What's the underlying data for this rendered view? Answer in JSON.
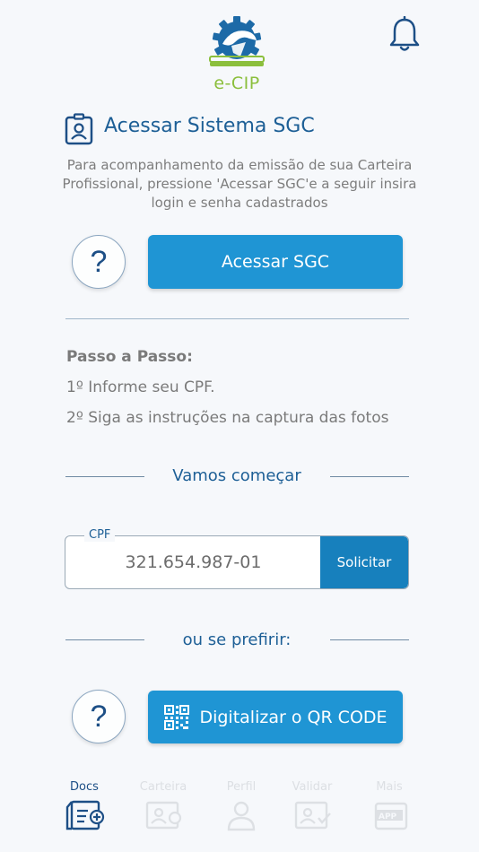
{
  "header": {
    "logo_text": "e-CIP"
  },
  "sgc": {
    "title": "Acessar Sistema SGC",
    "description": "Para acompanhamento da emissão de sua Carteira Profissional, pressione 'Acessar SGC'e a seguir insira login e senha cadastrados",
    "button_label": "Acessar SGC",
    "help_label": "?"
  },
  "steps": {
    "title": "Passo a Passo:",
    "items": [
      "1º Informe seu CPF.",
      "2º Siga as instruções na captura das fotos"
    ]
  },
  "start": {
    "label": "Vamos começar"
  },
  "cpf": {
    "legend": "CPF",
    "value": "321.654.987-01",
    "button_label": "Solicitar"
  },
  "alternative": {
    "label": "ou se prefirir:",
    "help_label": "?",
    "qr_button_label": "Digitalizar o QR CODE"
  },
  "nav": {
    "items": [
      {
        "label": "Docs",
        "icon": "docs-icon",
        "active": true
      },
      {
        "label": "Carteira",
        "icon": "wallet-card-icon",
        "active": false
      },
      {
        "label": "Perfil",
        "icon": "profile-icon",
        "active": false
      },
      {
        "label": "Validar",
        "icon": "validate-icon",
        "active": false
      },
      {
        "label": "Mais",
        "icon": "app-more-icon",
        "active": false
      }
    ]
  },
  "colors": {
    "primary": "#1f95d4",
    "primary_dark": "#1780bd",
    "title_blue": "#1d5f96",
    "logo_green": "#8bbf3c",
    "background": "#f6f8fb"
  }
}
